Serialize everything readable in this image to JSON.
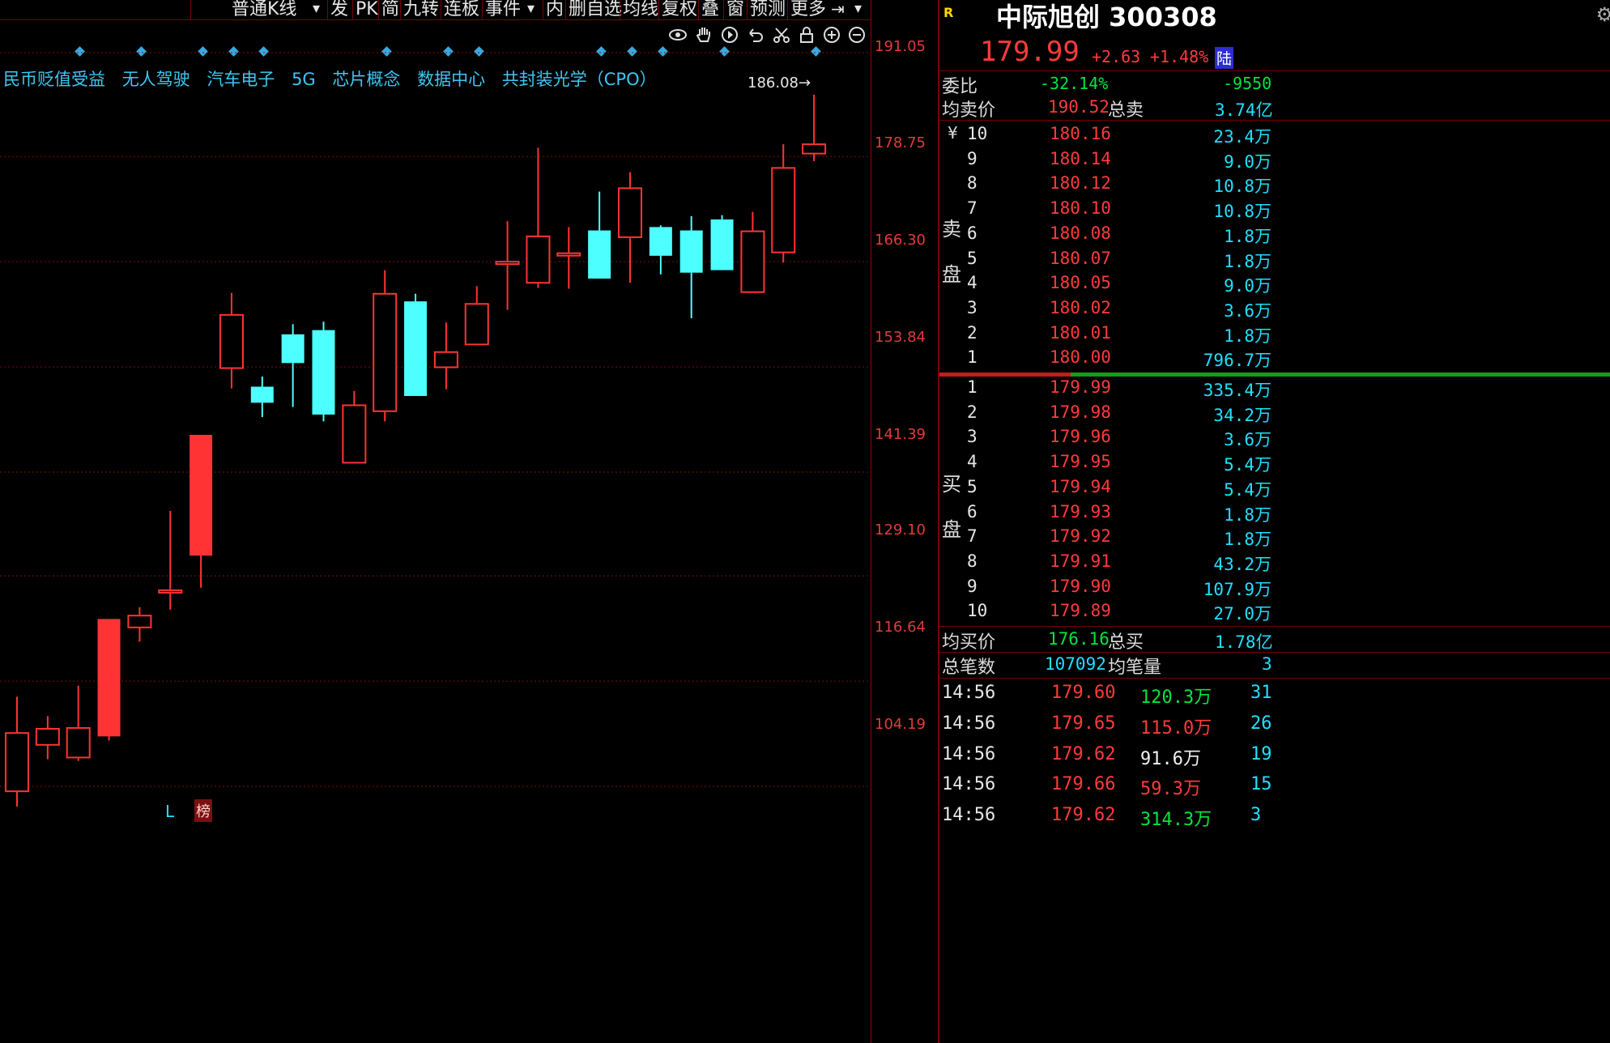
{
  "toolbar": {
    "items": [
      "普通K线",
      "发",
      "PK",
      "简",
      "九转",
      "连板",
      "事件",
      "内",
      "删自选",
      "均线",
      "复权",
      "叠",
      "窗",
      "预测",
      "更多"
    ]
  },
  "chart_icons": [
    "eye-icon",
    "hand-icon",
    "play-icon",
    "undo-icon",
    "scissors-icon",
    "lock-icon",
    "zoom-in-icon",
    "zoom-out-icon"
  ],
  "concepts": [
    "民币贬值受益",
    "无人驾驶",
    "汽车电子",
    "5G",
    "芯片概念",
    "数据中心",
    "共封装光学（CPO）"
  ],
  "chart": {
    "high_marker": "186.08",
    "bottom_left_marker": "L",
    "bottom_tag": "榜",
    "price_axis": [
      "191.05",
      "178.75",
      "166.30",
      "153.84",
      "141.39",
      "129.10",
      "116.64",
      "104.19"
    ]
  },
  "chart_data": {
    "type": "candlestick",
    "ylim": [
      97.96,
      197.28
    ],
    "candles": [
      {
        "o": 103.6,
        "c": 110.5,
        "h": 114.8,
        "l": 101.8
      },
      {
        "o": 109.1,
        "c": 111.0,
        "h": 112.5,
        "l": 107.4
      },
      {
        "o": 107.6,
        "c": 111.1,
        "h": 116.1,
        "l": 107.2
      },
      {
        "o": 110.1,
        "c": 124.0,
        "h": 124.0,
        "l": 109.6
      },
      {
        "o": 123.0,
        "c": 124.4,
        "h": 125.4,
        "l": 121.3
      },
      {
        "o": 127.4,
        "c": 127.4,
        "h": 136.8,
        "l": 125.1
      },
      {
        "o": 131.5,
        "c": 145.8,
        "h": 145.8,
        "l": 127.7
      },
      {
        "o": 153.7,
        "c": 160.0,
        "h": 162.6,
        "l": 151.3
      },
      {
        "o": 151.5,
        "c": 149.6,
        "h": 152.7,
        "l": 147.9
      },
      {
        "o": 157.7,
        "c": 154.3,
        "h": 158.9,
        "l": 149.1
      },
      {
        "o": 158.2,
        "c": 148.2,
        "h": 159.2,
        "l": 147.4
      },
      {
        "o": 142.5,
        "c": 149.3,
        "h": 151.0,
        "l": 142.5
      },
      {
        "o": 148.6,
        "c": 162.5,
        "h": 165.3,
        "l": 147.4
      },
      {
        "o": 161.6,
        "c": 150.4,
        "h": 162.5,
        "l": 150.4
      },
      {
        "o": 153.8,
        "c": 155.6,
        "h": 159.1,
        "l": 151.2
      },
      {
        "o": 156.5,
        "c": 161.3,
        "h": 163.4,
        "l": 156.5
      },
      {
        "o": 166.3,
        "c": 166.3,
        "h": 171.1,
        "l": 160.6
      },
      {
        "o": 163.8,
        "c": 169.3,
        "h": 179.8,
        "l": 163.2
      },
      {
        "o": 167.3,
        "c": 167.3,
        "h": 170.4,
        "l": 163.1
      },
      {
        "o": 170.0,
        "c": 164.3,
        "h": 174.6,
        "l": 164.3
      },
      {
        "o": 169.2,
        "c": 175.0,
        "h": 176.9,
        "l": 163.8
      },
      {
        "o": 170.4,
        "c": 167.0,
        "h": 170.6,
        "l": 164.8
      },
      {
        "o": 170.0,
        "c": 165.0,
        "h": 171.7,
        "l": 159.6
      },
      {
        "o": 171.3,
        "c": 165.3,
        "h": 171.8,
        "l": 165.3
      },
      {
        "o": 162.7,
        "c": 169.9,
        "h": 172.2,
        "l": 162.7
      },
      {
        "o": 167.4,
        "c": 177.4,
        "h": 180.2,
        "l": 166.2
      },
      {
        "o": 179.1,
        "c": 180.2,
        "h": 186.08,
        "l": 178.2
      }
    ]
  },
  "quote": {
    "badge": "R",
    "name": "中际旭创",
    "code": "300308",
    "price": "179.99",
    "change": "+2.63",
    "change_pct": "+1.48%",
    "market_badge": "陆"
  },
  "panel": {
    "weibi_label": "委比",
    "weibi_pct": "-32.14%",
    "weibi_diff": "-9550",
    "avg_sell_label": "均卖价",
    "avg_sell": "190.52",
    "total_sell_label": "总卖",
    "total_sell": "3.74亿",
    "sell_side_label": "卖盘",
    "sell_currency": "¥",
    "buy_side_label": "买盘",
    "avg_buy_label": "均买价",
    "avg_buy": "176.16",
    "total_buy_label": "总买",
    "total_buy": "1.78亿",
    "trades_label": "总笔数",
    "trades": "107092",
    "avg_vol_label": "均笔量",
    "avg_vol": "3"
  },
  "sell_orders": [
    {
      "level": "10",
      "price": "180.16",
      "vol": "23.4万"
    },
    {
      "level": "9",
      "price": "180.14",
      "vol": "9.0万"
    },
    {
      "level": "8",
      "price": "180.12",
      "vol": "10.8万"
    },
    {
      "level": "7",
      "price": "180.10",
      "vol": "10.8万"
    },
    {
      "level": "6",
      "price": "180.08",
      "vol": "1.8万"
    },
    {
      "level": "5",
      "price": "180.07",
      "vol": "1.8万"
    },
    {
      "level": "4",
      "price": "180.05",
      "vol": "9.0万"
    },
    {
      "level": "3",
      "price": "180.02",
      "vol": "3.6万"
    },
    {
      "level": "2",
      "price": "180.01",
      "vol": "1.8万"
    },
    {
      "level": "1",
      "price": "180.00",
      "vol": "796.7万"
    }
  ],
  "buy_orders": [
    {
      "level": "1",
      "price": "179.99",
      "vol": "335.4万"
    },
    {
      "level": "2",
      "price": "179.98",
      "vol": "34.2万"
    },
    {
      "level": "3",
      "price": "179.96",
      "vol": "3.6万"
    },
    {
      "level": "4",
      "price": "179.95",
      "vol": "5.4万"
    },
    {
      "level": "5",
      "price": "179.94",
      "vol": "5.4万"
    },
    {
      "level": "6",
      "price": "179.93",
      "vol": "1.8万"
    },
    {
      "level": "7",
      "price": "179.92",
      "vol": "1.8万"
    },
    {
      "level": "8",
      "price": "179.91",
      "vol": "43.2万"
    },
    {
      "level": "9",
      "price": "179.90",
      "vol": "107.9万"
    },
    {
      "level": "10",
      "price": "179.89",
      "vol": "27.0万"
    }
  ],
  "ticks": [
    {
      "time": "14:56",
      "price": "179.60",
      "amount": "120.3万",
      "count": "31",
      "dir": "green"
    },
    {
      "time": "14:56",
      "price": "179.65",
      "amount": "115.0万",
      "count": "26",
      "dir": "red"
    },
    {
      "time": "14:56",
      "price": "179.62",
      "amount": "91.6万",
      "count": "19",
      "dir": "white"
    },
    {
      "time": "14:56",
      "price": "179.66",
      "amount": "59.3万",
      "count": "15",
      "dir": "red"
    },
    {
      "time": "14:56",
      "price": "179.62",
      "amount": "314.3万",
      "count": "3",
      "dir": "green"
    }
  ],
  "colors": {
    "up": "#ff3333",
    "down": "#4dffff",
    "grid": "#7a1010",
    "axis_text": "#e23b3b",
    "concept": "#3ec7f0"
  }
}
